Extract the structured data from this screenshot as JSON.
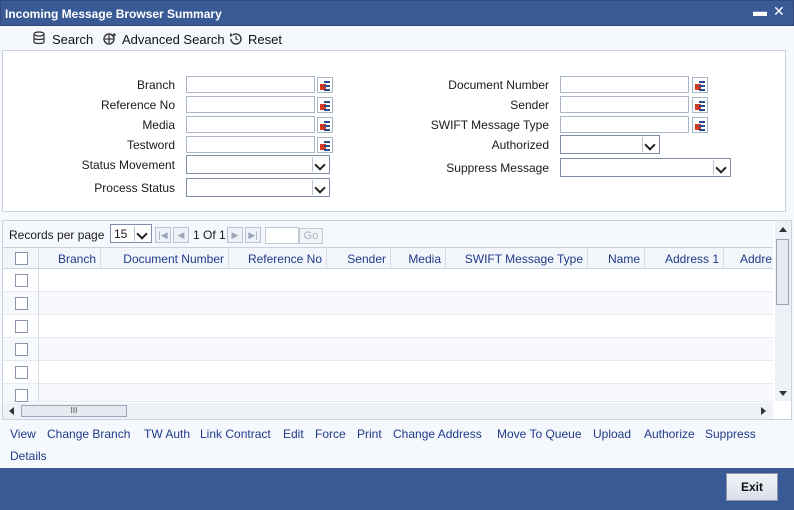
{
  "window": {
    "title": "Incoming Message Browser Summary"
  },
  "toolbar": {
    "search": "Search",
    "advanced_search": "Advanced Search",
    "reset": "Reset"
  },
  "form": {
    "branch": "Branch",
    "reference_no": "Reference No",
    "media": "Media",
    "testword": "Testword",
    "status_movement": "Status Movement",
    "process_status": "Process Status",
    "document_number": "Document Number",
    "sender": "Sender",
    "swift_message_type": "SWIFT Message Type",
    "authorized": "Authorized",
    "suppress_message": "Suppress Message"
  },
  "pager": {
    "records_label": "Records per page",
    "per_page": "15",
    "page_count": "1 Of 1",
    "go": "Go"
  },
  "table": {
    "columns": [
      "Branch",
      "Document Number",
      "Reference No",
      "Sender",
      "Media",
      "SWIFT Message Type",
      "Name",
      "Address 1",
      "Addre"
    ]
  },
  "actions": [
    "View",
    "Change Branch",
    "TW Auth",
    "Link Contract",
    "Edit",
    "Force",
    "Print",
    "Change Address",
    "Move To Queue",
    "Upload",
    "Authorize",
    "Suppress",
    "Details"
  ],
  "footer": {
    "exit": "Exit"
  },
  "colors": {
    "title_bar": "#3a5a96",
    "link": "#1f3a8a",
    "lov_red": "#d23a1f"
  }
}
